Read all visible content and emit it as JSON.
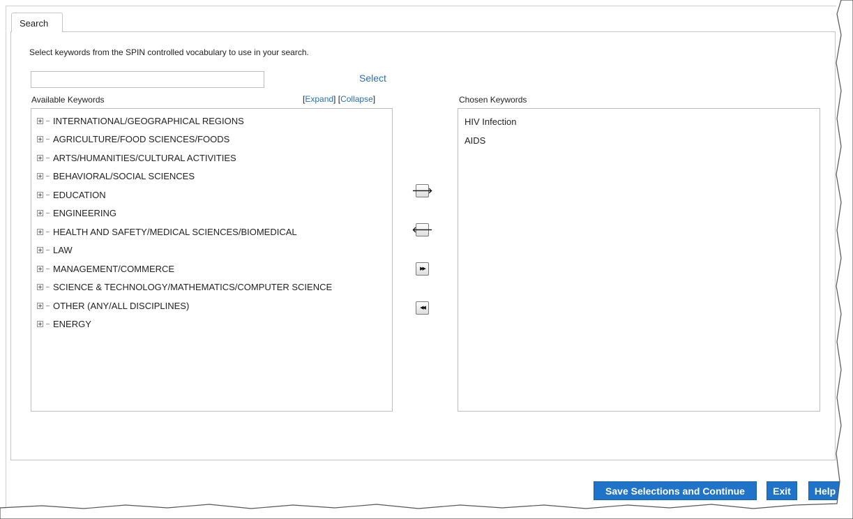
{
  "tab": {
    "label": "Search"
  },
  "instructions": "Select keywords from the SPIN controlled vocabulary to use in your search.",
  "search": {
    "value": "",
    "placeholder": "",
    "select_label": "Select"
  },
  "available": {
    "label": "Available Keywords",
    "expand_label": "Expand",
    "collapse_label": "Collapse",
    "open_bracket": "[",
    "mid_bracket": "] [",
    "close_bracket": "]",
    "items": [
      "INTERNATIONAL/GEOGRAPHICAL REGIONS",
      "AGRICULTURE/FOOD SCIENCES/FOODS",
      "ARTS/HUMANITIES/CULTURAL ACTIVITIES",
      "BEHAVIORAL/SOCIAL SCIENCES",
      "EDUCATION",
      "ENGINEERING",
      "HEALTH AND SAFETY/MEDICAL SCIENCES/BIOMEDICAL",
      "LAW",
      "MANAGEMENT/COMMERCE",
      "SCIENCE & TECHNOLOGY/MATHEMATICS/COMPUTER SCIENCE",
      "OTHER (ANY/ALL DISCIPLINES)",
      "ENERGY"
    ]
  },
  "chosen": {
    "label": "Chosen Keywords",
    "items": [
      "HIV Infection",
      "AIDS"
    ]
  },
  "transfer_buttons": {
    "add_glyph": "🡒",
    "remove_glyph": "🡐",
    "add_all_glyph": "▶▶",
    "remove_all_glyph": "◀◀"
  },
  "footer": {
    "save_label": "Save Selections and Continue",
    "exit_label": "Exit",
    "help_label": "Help"
  },
  "colors": {
    "link": "#2a6fb5",
    "button": "#1f73c9"
  }
}
